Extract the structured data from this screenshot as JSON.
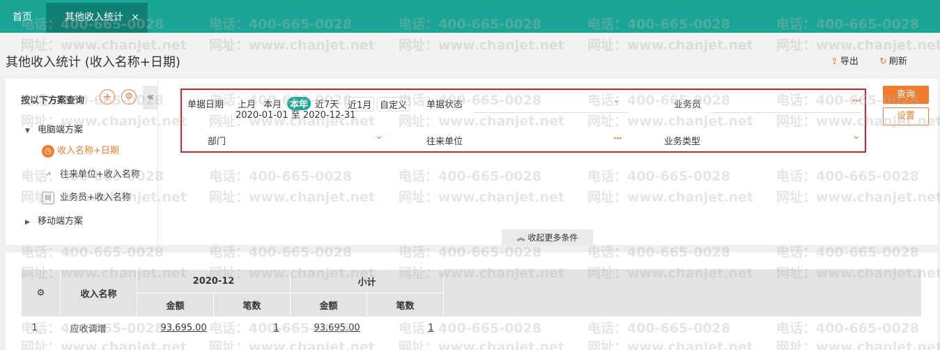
{
  "tabs": {
    "home": "首页",
    "active": "其他收入统计",
    "close": "×"
  },
  "page": {
    "title": "其他收入统计 (收入名称+日期)"
  },
  "toolbar": {
    "export": "导出",
    "refresh": "刷新"
  },
  "scheme": {
    "header": "按以下方案查询",
    "add_icon": "+",
    "settings_icon": "⚙",
    "collapse_icon": "«",
    "groups": {
      "pc": "电脑端方案",
      "mobile": "移动端方案"
    },
    "items": [
      "收入名称+日期",
      "往来单位+收入名称",
      "业务员+收入名称"
    ]
  },
  "filters": {
    "date_label": "单据日期",
    "periods": [
      "上月",
      "本月",
      "本年",
      "近7天",
      "近1月",
      "自定义"
    ],
    "active_period": "本年",
    "date_range": "2020-01-01 至 2020-12-31",
    "status_label": "单据状态",
    "salesman_label": "业务员",
    "department_label": "部门",
    "partner_label": "往来单位",
    "biztype_label": "业务类型"
  },
  "buttons": {
    "query": "查询",
    "settings": "设置",
    "more_conditions": "收起更多条件"
  },
  "table": {
    "headers": {
      "name": "收入名称",
      "period": "2020-12",
      "subtotal": "小计",
      "amount": "金额",
      "count": "笔数"
    },
    "rows": [
      {
        "index": "1",
        "name": "应收调增",
        "amount": "93,695.00",
        "count": "1",
        "sub_amount": "93,695.00",
        "sub_count": "1"
      }
    ]
  },
  "watermark": {
    "phone": "电话：400-665-0028",
    "site": "网址：www.chanjet.net"
  },
  "colors": {
    "teal": "#1aa596",
    "teal_dark": "#118074",
    "orange": "#f07c2e",
    "red": "#e02020"
  }
}
